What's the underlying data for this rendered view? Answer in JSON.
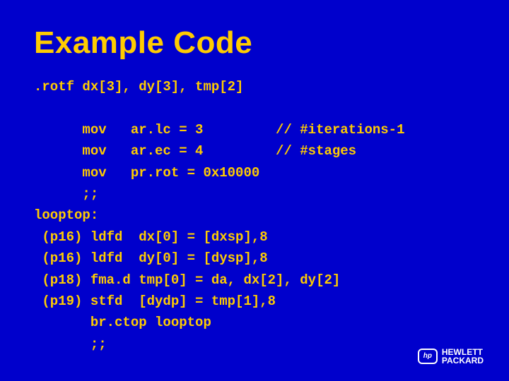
{
  "title": "Example Code",
  "code_lines": [
    ".rotf dx[3], dy[3], tmp[2]",
    "",
    "      mov   ar.lc = 3         // #iterations-1",
    "      mov   ar.ec = 4         // #stages",
    "      mov   pr.rot = 0x10000",
    "      ;;",
    "looptop:",
    " (p16) ldfd  dx[0] = [dxsp],8",
    " (p16) ldfd  dy[0] = [dysp],8",
    " (p18) fma.d tmp[0] = da, dx[2], dy[2]",
    " (p19) stfd  [dydp] = tmp[1],8",
    "       br.ctop looptop",
    "       ;;"
  ],
  "logo": {
    "mark": "hp",
    "line1": "HEWLETT",
    "line2": "PACKARD"
  }
}
